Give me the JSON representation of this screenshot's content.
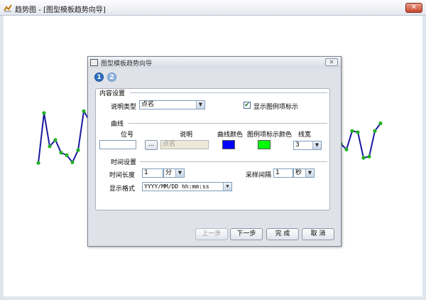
{
  "window": {
    "title": "趋势图 - [图型模板趋势向导]",
    "close_label": "✕"
  },
  "dialog": {
    "title": "图型模板趋势向导",
    "close_label": "✕",
    "steps": [
      "1",
      "2"
    ],
    "content_section": {
      "title": "内容设置",
      "desc_type_label": "说明类型",
      "desc_type_value": "点名",
      "show_legend_label": "显示图例项标示",
      "show_legend_checked": true
    },
    "curve_section": {
      "title": "曲线",
      "headers": {
        "point": "位号",
        "desc": "说明",
        "curve_color": "曲线颜色",
        "legend_color": "图例项标示颜色",
        "line_width": "线宽"
      },
      "point_value": "",
      "browse_label": "...",
      "desc_placeholder": "点名",
      "curve_color": "#0000ff",
      "legend_color": "#00ff00",
      "line_width_value": "3"
    },
    "time_section": {
      "title": "时间设置",
      "duration_label": "时间长度",
      "duration_value": "1",
      "duration_unit": "分",
      "sample_label": "采样间隔",
      "sample_value": "1",
      "sample_unit": "秒",
      "format_label": "显示格式",
      "format_value": "YYYY/MM/DD hh:mm:ss"
    },
    "buttons": {
      "prev": "上一步",
      "next": "下一步",
      "finish": "完 成",
      "cancel": "取 消"
    }
  },
  "chart_data": {
    "type": "line",
    "title": "",
    "xlabel": "",
    "ylabel": "",
    "line_color": "#1a1aa0",
    "marker_color": "#22b022",
    "x": [
      0,
      1,
      2,
      3,
      4,
      5,
      6,
      7,
      8,
      9,
      10,
      11,
      12,
      13,
      14,
      15,
      16,
      17,
      18
    ],
    "values": [
      0.12,
      0.9,
      0.38,
      0.48,
      0.28,
      0.24,
      0.13,
      0.32,
      0.93,
      0.78,
      0.55,
      0.42,
      0.33,
      0.62,
      0.6,
      0.2,
      0.22,
      0.62,
      0.74
    ],
    "ylim": [
      0,
      1
    ]
  }
}
